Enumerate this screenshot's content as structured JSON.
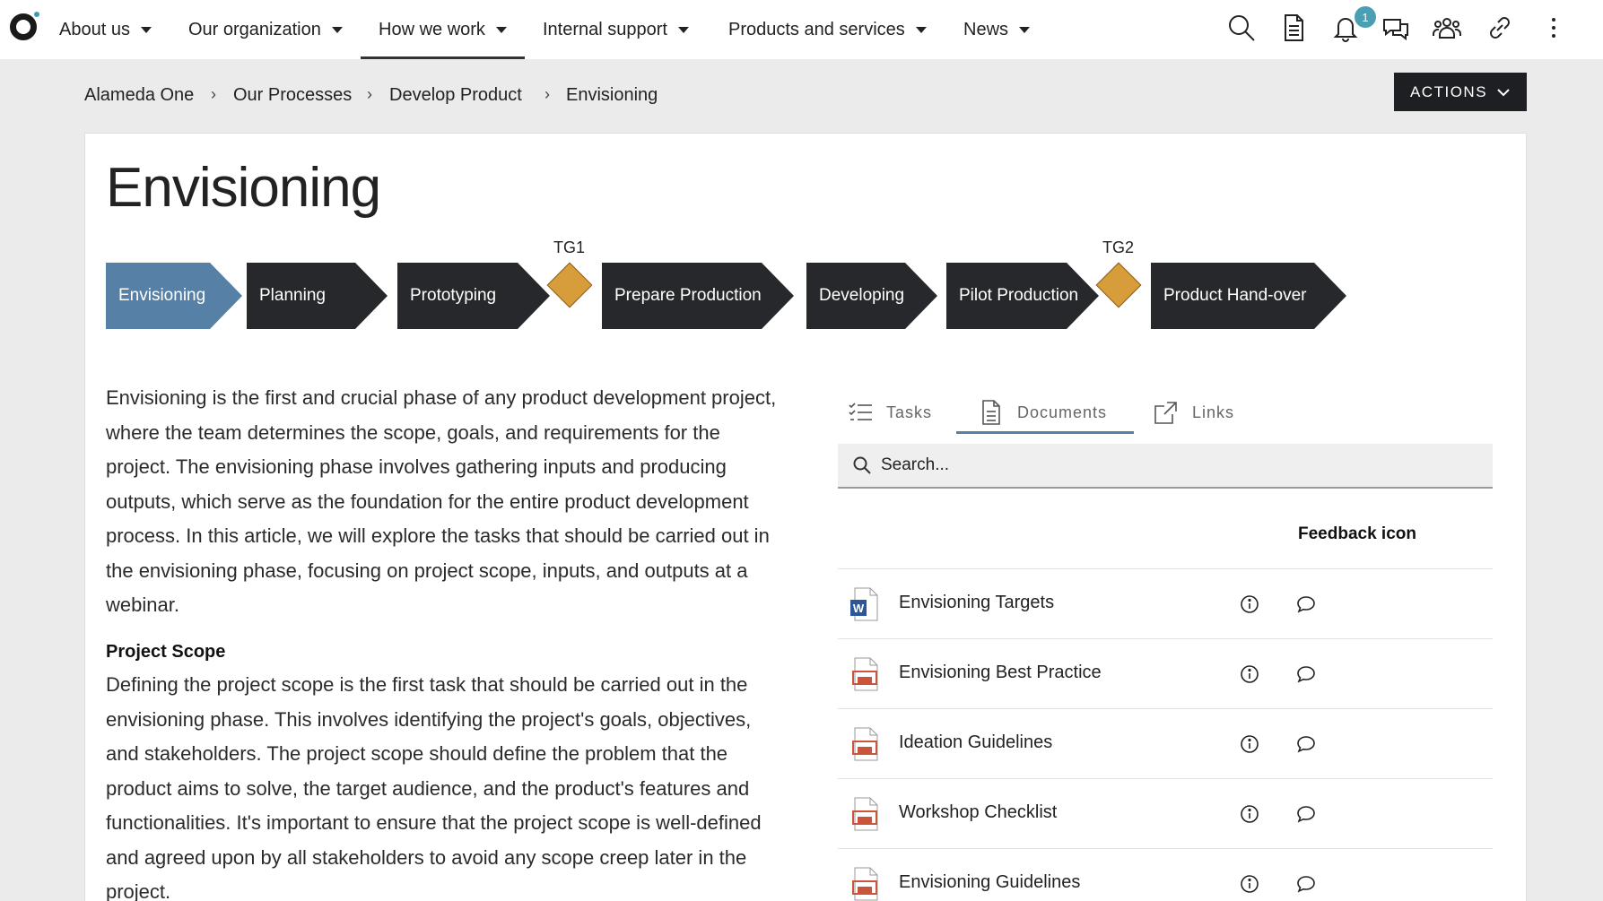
{
  "nav": {
    "items": [
      {
        "label": "About us"
      },
      {
        "label": "Our organization"
      },
      {
        "label": "How we work"
      },
      {
        "label": "Internal support"
      },
      {
        "label": "Products and services"
      },
      {
        "label": "News"
      }
    ],
    "notification_count": "1"
  },
  "breadcrumb": [
    "Alameda One",
    "Our Processes",
    "Develop Product",
    "Envisioning"
  ],
  "actions_label": "ACTIONS",
  "page_title": "Envisioning",
  "flow": {
    "steps": [
      "Envisioning",
      "Planning",
      "Prototyping",
      "Prepare Production",
      "Developing",
      "Pilot Production",
      "Product Hand-over"
    ],
    "gates": [
      "TG1",
      "TG2"
    ]
  },
  "content": {
    "intro": "Envisioning is the first and crucial phase of any product development project, where the team determines the scope, goals, and requirements for the project. The envisioning phase involves gathering inputs and producing outputs, which serve as the foundation for the entire product development process. In this article, we will explore the tasks that should be carried out in the envisioning phase, focusing on project scope, inputs, and outputs at a webinar.",
    "scope_heading": "Project Scope",
    "scope_text": "Defining the project scope is the first task that should be carried out in the envisioning phase. This involves identifying the project's goals, objectives, and stakeholders. The project scope should define the problem that the product aims to solve, the target audience, and the product's features and functionalities. It's important to ensure that the project scope is well-defined and agreed upon by all stakeholders to avoid any scope creep later in the project."
  },
  "panel": {
    "tabs": [
      "Tasks",
      "Documents",
      "Links"
    ],
    "active_tab": "Documents",
    "search_placeholder": "Search...",
    "column_header": "Feedback icon",
    "documents": [
      {
        "name": "Envisioning Targets",
        "type": "word"
      },
      {
        "name": "Envisioning Best Practice",
        "type": "presentation"
      },
      {
        "name": "Ideation Guidelines",
        "type": "presentation"
      },
      {
        "name": "Workshop Checklist",
        "type": "presentation"
      },
      {
        "name": "Envisioning Guidelines",
        "type": "presentation"
      }
    ]
  }
}
